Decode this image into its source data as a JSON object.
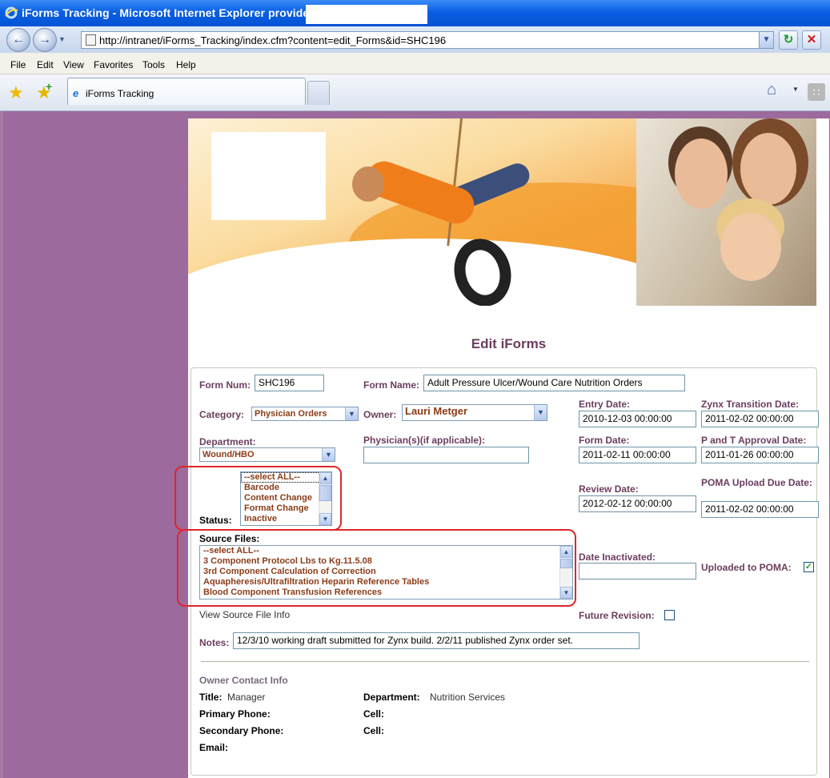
{
  "window": {
    "title": "iForms Tracking - Microsoft Internet Explorer provided by"
  },
  "browser": {
    "url": "http://intranet/iForms_Tracking/index.cfm?content=edit_Forms&id=SHC196",
    "menu": [
      "File",
      "Edit",
      "View",
      "Favorites",
      "Tools",
      "Help"
    ],
    "tab_title": "iForms Tracking"
  },
  "page": {
    "heading": "Edit iForms"
  },
  "form": {
    "form_num_label": "Form Num:",
    "form_num": "SHC196",
    "form_name_label": "Form Name:",
    "form_name": "Adult Pressure Ulcer/Wound Care Nutrition Orders",
    "category_label": "Category:",
    "category": "Physician Orders",
    "owner_label": "Owner:",
    "owner": "Lauri Metger",
    "department_label": "Department:",
    "department": "Wound/HBO",
    "physicians_label": "Physician(s)(if applicable):",
    "physicians": "",
    "status_label": "Status:",
    "status_options": [
      "--select ALL--",
      "Barcode",
      "Content Change",
      "Format Change",
      "Inactive"
    ],
    "source_files_label": "Source Files:",
    "source_files": [
      "--select ALL--",
      "3 Component Protocol Lbs to Kg.11.5.08",
      "3rd Component Calculation of Correction",
      "Aquapheresis/Ultrafiltration Heparin Reference Tables",
      "Blood Component Transfusion References"
    ],
    "view_source_link": "View Source File Info",
    "notes_label": "Notes:",
    "notes": "12/3/10 working draft submitted for Zynx build. 2/2/11 published Zynx order set.",
    "entry_date_label": "Entry Date:",
    "entry_date": "2010-12-03 00:00:00",
    "zynx_label": "Zynx Transition Date:",
    "zynx_date": "2011-02-02 00:00:00",
    "form_date_label": "Form Date:",
    "form_date": "2011-02-11 00:00:00",
    "pt_label": "P and T Approval Date:",
    "pt_date": "2011-01-26 00:00:00",
    "review_date_label": "Review Date:",
    "review_date": "2012-02-12 00:00:00",
    "poma_due_label": "POMA Upload Due Date:",
    "poma_due_date": "2011-02-02 00:00:00",
    "inactivated_label": "Date Inactivated:",
    "inactivated_date": "",
    "uploaded_label": "Uploaded to POMA:",
    "uploaded_checked": true,
    "future_label": "Future Revision:",
    "future_checked": false
  },
  "contact": {
    "heading": "Owner Contact Info",
    "title_label": "Title:",
    "title": "Manager",
    "department_label": "Department:",
    "department": "Nutrition Services",
    "primary_label": "Primary Phone:",
    "cell_label": "Cell:",
    "secondary_label": "Secondary Phone:",
    "cell2_label": "Cell:",
    "email_label": "Email:"
  },
  "colors": {
    "page_background": "#9c6a9c",
    "label_purple": "#6b3d5f",
    "option_brown": "#8b3c17",
    "highlight_red": "#e0262a"
  }
}
